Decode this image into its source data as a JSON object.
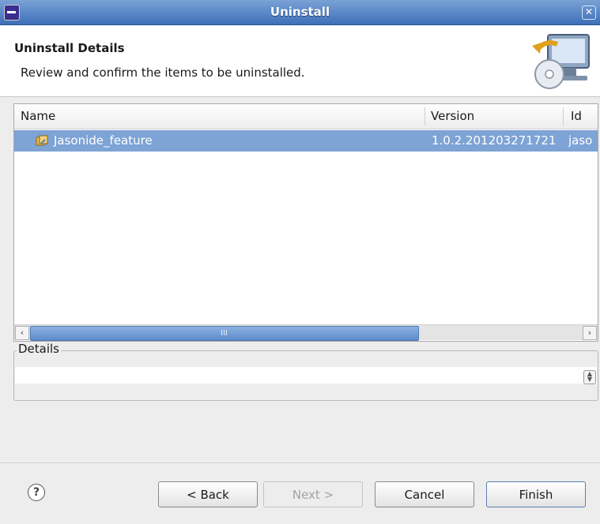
{
  "window": {
    "title": "Uninstall"
  },
  "header": {
    "heading": "Uninstall Details",
    "description": "Review and confirm the items to be uninstalled."
  },
  "table": {
    "columns": [
      "Name",
      "Version",
      "Id"
    ],
    "rows": [
      {
        "name": "Jasonide_feature",
        "version": "1.0.2.201203271721",
        "id": "jaso",
        "selected": true
      }
    ]
  },
  "scrollbar": {
    "grip": "III"
  },
  "details": {
    "label": "Details",
    "text": ""
  },
  "buttons": {
    "help": "?",
    "back": "< Back",
    "next": "Next >",
    "cancel": "Cancel",
    "finish": "Finish"
  },
  "colors": {
    "titlebar": "#3d6fb8",
    "selection": "#7ea3d5"
  }
}
